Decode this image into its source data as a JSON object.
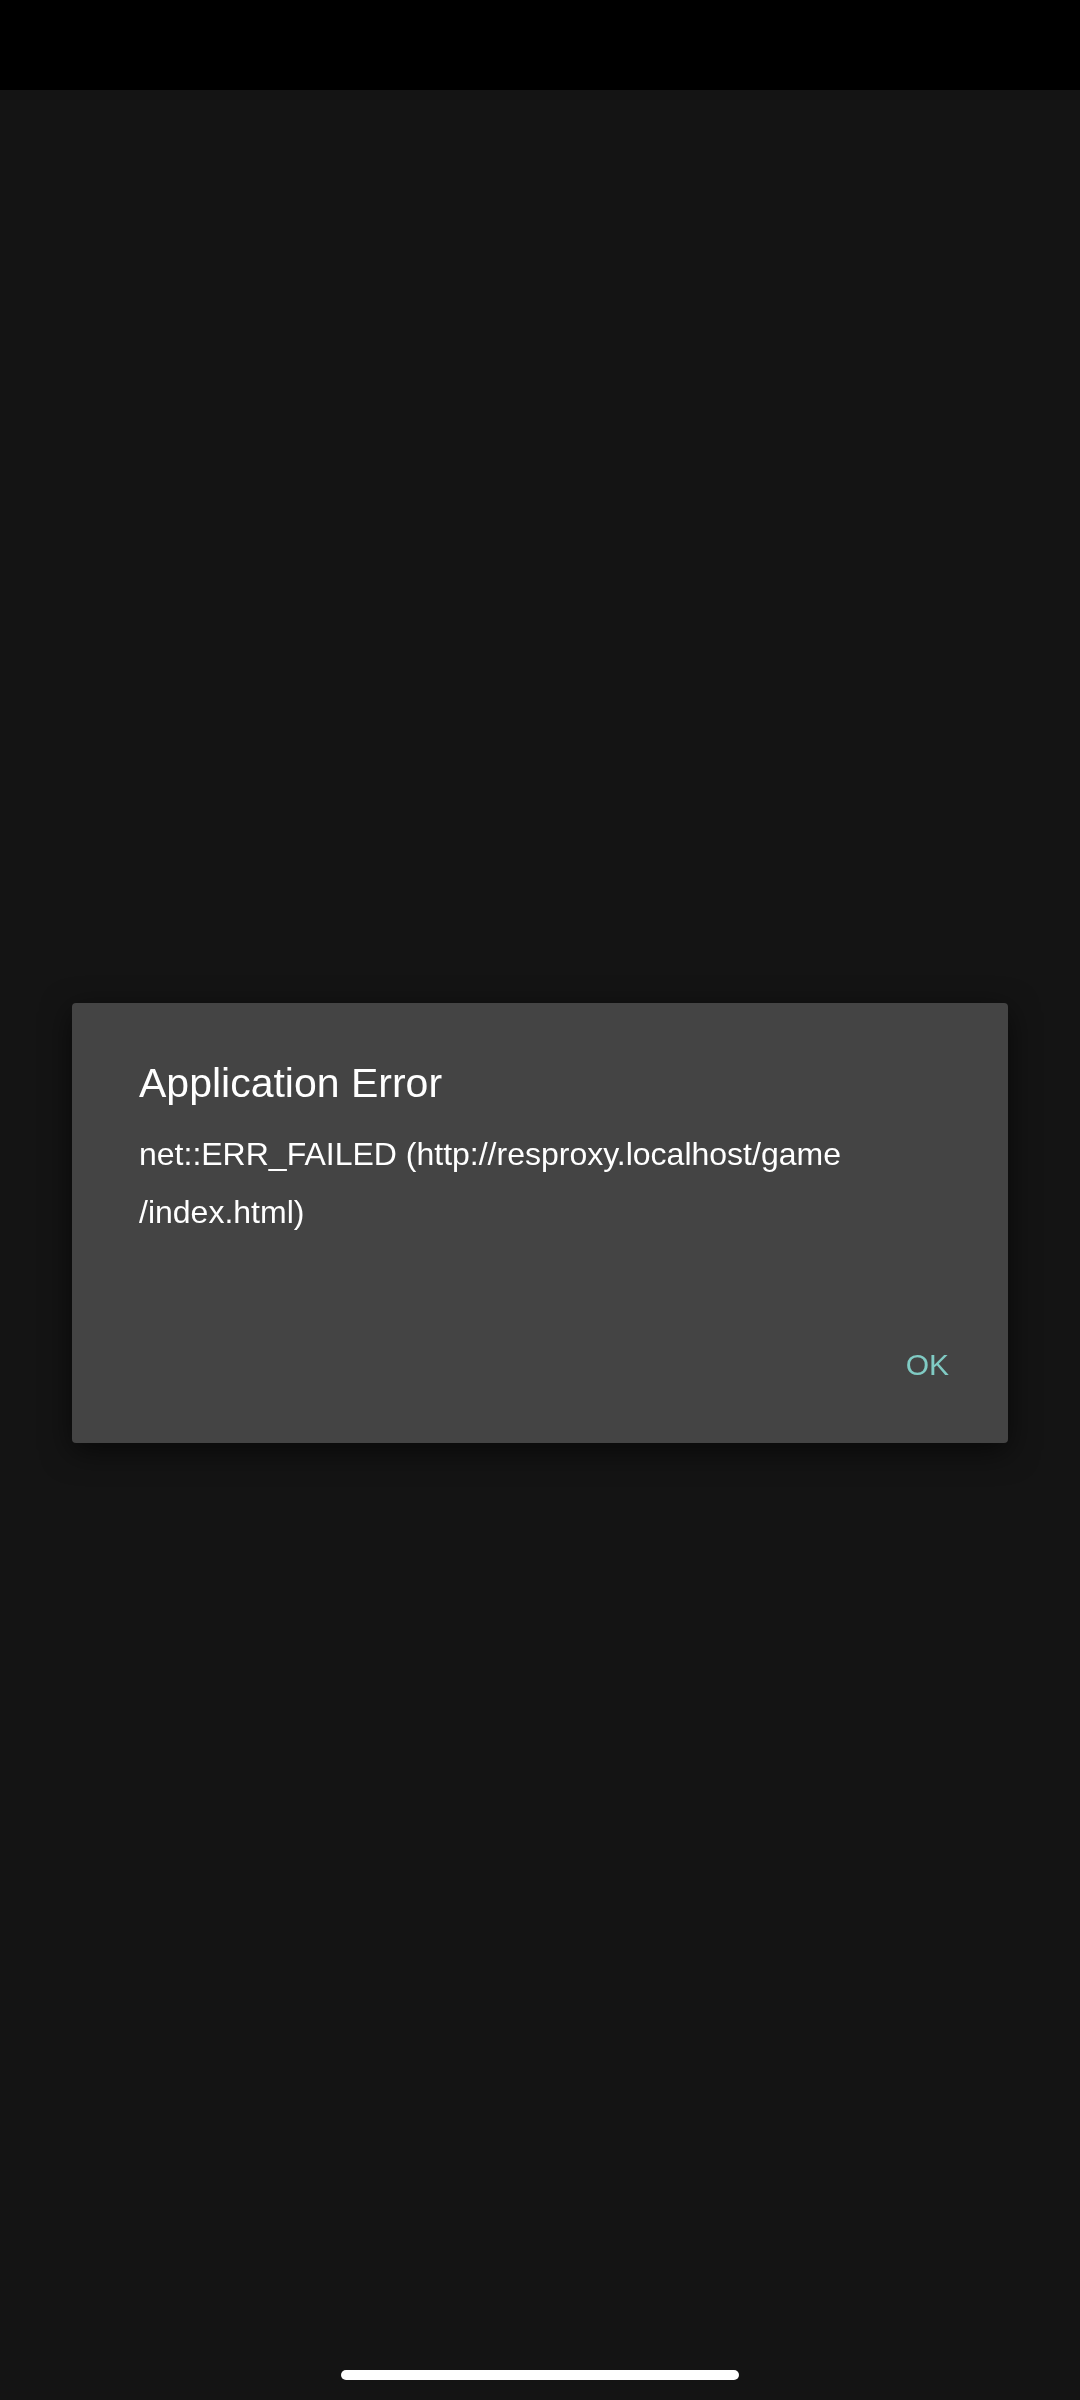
{
  "dialog": {
    "title": "Application Error",
    "message_lines": [
      "net::ERR_FAILED (http://resproxy.localhost/game",
      "/index.html)"
    ],
    "buttons": [
      "OK"
    ]
  }
}
